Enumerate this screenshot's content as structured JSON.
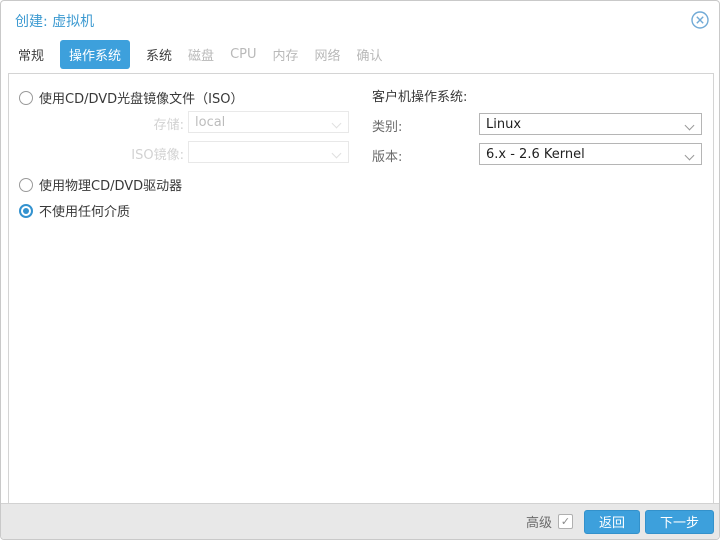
{
  "dialog": {
    "title": "创建: 虚拟机"
  },
  "tabs": [
    {
      "label": "常规",
      "state": "enabled"
    },
    {
      "label": "操作系统",
      "state": "active"
    },
    {
      "label": "系统",
      "state": "enabled"
    },
    {
      "label": "磁盘",
      "state": "disabled"
    },
    {
      "label": "CPU",
      "state": "disabled"
    },
    {
      "label": "内存",
      "state": "disabled"
    },
    {
      "label": "网络",
      "state": "disabled"
    },
    {
      "label": "确认",
      "state": "disabled"
    }
  ],
  "media": {
    "iso_option": {
      "label": "使用CD/DVD光盘镜像文件（ISO）",
      "checked": false
    },
    "storage_field": {
      "label": "存储:",
      "value": "local",
      "disabled": true
    },
    "iso_image_field": {
      "label": "ISO镜像:",
      "value": "",
      "disabled": true
    },
    "physical_option": {
      "label": "使用物理CD/DVD驱动器",
      "checked": false
    },
    "no_media_option": {
      "label": "不使用任何介质",
      "checked": true
    }
  },
  "guest_os": {
    "header": "客户机操作系统:",
    "type_field": {
      "label": "类别:",
      "value": "Linux"
    },
    "version_field": {
      "label": "版本:",
      "value": "6.x - 2.6 Kernel"
    }
  },
  "footer": {
    "advanced_label": "高级",
    "advanced_checked": true,
    "check_glyph": "✓",
    "back_button": "返回",
    "next_button": "下一步"
  },
  "colors": {
    "accent_blue": "#3da0dc",
    "title_blue": "#3d9ad1",
    "footer_bg": "#e8e8e8",
    "disabled_gray": "#b9b9b9"
  }
}
